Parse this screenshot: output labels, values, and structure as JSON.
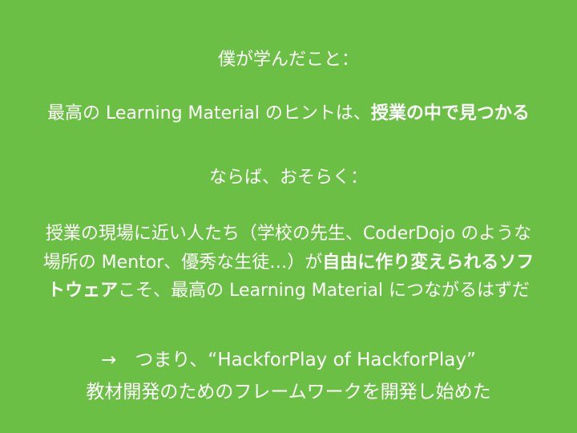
{
  "slide": {
    "background_color": "#6cbf45",
    "text_color": "#ffffff",
    "line1": "僕が学んだこと：",
    "line2": {
      "normal": "最高の Learning Material のヒントは、",
      "bold": "授業の中で見つかる"
    },
    "line3": "ならば、おそらく：",
    "paragraph": {
      "line1": "授業の現場に近い人たち（学校の先生、CoderDojo のような",
      "line2_normal": "場所の Mentor、優秀な生徒…）が",
      "line2_bold": "自由に作り変えられるソフ",
      "line3_bold": "トウェア",
      "line3_normal": "こそ、最高の Learning Material につながるはずだ"
    },
    "conclusion": {
      "line1": "→　つまり、“HackforPlay of HackforPlay”",
      "line2": "教材開発のためのフレームワークを開発し始めた"
    }
  }
}
